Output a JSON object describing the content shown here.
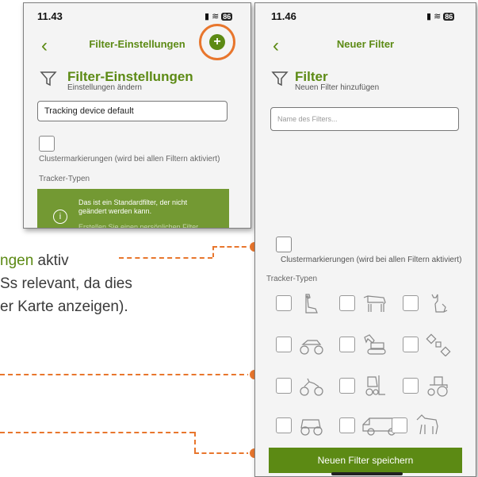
{
  "background_doc": {
    "line1_green": "ngen",
    "line1_rest": " aktiv",
    "line2": "Ss relevant, da dies",
    "line3": "er Karte anzeigen)."
  },
  "left_phone": {
    "time": "11.43",
    "battery": "86",
    "nav_title": "Filter-Einstellungen",
    "back_icon": "chevron-left",
    "add_icon": "plus-circle",
    "section_title": "Filter-Einstellungen",
    "section_subtitle": "Einstellungen ändern",
    "filter_name_value": "Tracking device default",
    "cluster_label": "Clustermarkierungen (wird bei allen Filtern aktiviert)",
    "tracker_types_label": "Tracker-Typen",
    "toast_text": "Das ist ein Standardfilter, der nicht geändert werden kann.",
    "toast_partial": "Erstellen Sie einen persönlichen Filter"
  },
  "right_phone": {
    "time": "11.46",
    "battery": "86",
    "nav_title": "Neuer Filter",
    "back_icon": "chevron-left",
    "section_title": "Filter",
    "section_subtitle": "Neuen Filter hinzufügen",
    "filter_name_placeholder": "Name des Filters...",
    "cluster_label": "Clustermarkierungen (wird bei allen Filtern aktiviert)",
    "tracker_types_label": "Tracker-Typen",
    "tracker_icons": [
      "dog",
      "cow",
      "cat",
      "atv",
      "excavator",
      "satellite",
      "quad",
      "forklift",
      "tractor",
      "utv",
      "van",
      "horse"
    ],
    "save_button": "Neuen Filter speichern"
  },
  "colors": {
    "accent_green": "#5c8a14",
    "callout_orange": "#e8762d"
  }
}
